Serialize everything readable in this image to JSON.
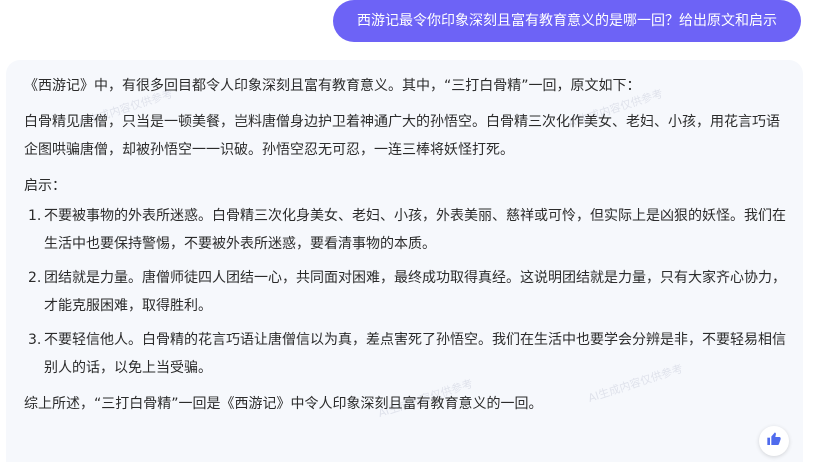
{
  "user_message": "西游记最令你印象深刻且富有教育意义的是哪一回？给出原文和启示",
  "answer": {
    "intro": "《西游记》中，有很多回目都令人印象深刻且富有教育意义。其中，“三打白骨精”一回，原文如下：",
    "original_text": "白骨精见唐僧，只当是一顿美餐，岂料唐僧身边护卫着神通广大的孙悟空。白骨精三次化作美女、老妇、小孩，用花言巧语企图哄骗唐僧，却被孙悟空一一识破。孙悟空忍无可忍，一连三棒将妖怪打死。",
    "insights_heading": "启示：",
    "insights": [
      {
        "num": "1.",
        "text": "不要被事物的外表所迷惑。白骨精三次化身美女、老妇、小孩，外表美丽、慈祥或可怜，但实际上是凶狠的妖怪。我们在生活中也要保持警惕，不要被外表所迷惑，要看清事物的本质。"
      },
      {
        "num": "2.",
        "text": "团结就是力量。唐僧师徒四人团结一心，共同面对困难，最终成功取得真经。这说明团结就是力量，只有大家齐心协力，才能克服困难，取得胜利。"
      },
      {
        "num": "3.",
        "text": "不要轻信他人。白骨精的花言巧语让唐僧信以为真，差点害死了孙悟空。我们在生活中也要学会分辨是非，不要轻易相信别人的话，以免上当受骗。"
      }
    ],
    "conclusion": "综上所述，“三打白骨精”一回是《西游记》中令人印象深刻且富有教育意义的一回。"
  },
  "watermark_text": "AI生成内容仅供参考",
  "colors": {
    "user_bubble": "#6d63f6",
    "card_bg": "#f6f8fc",
    "like_icon": "#4f6bed"
  },
  "icons": {
    "like": "thumbs-up-icon"
  }
}
